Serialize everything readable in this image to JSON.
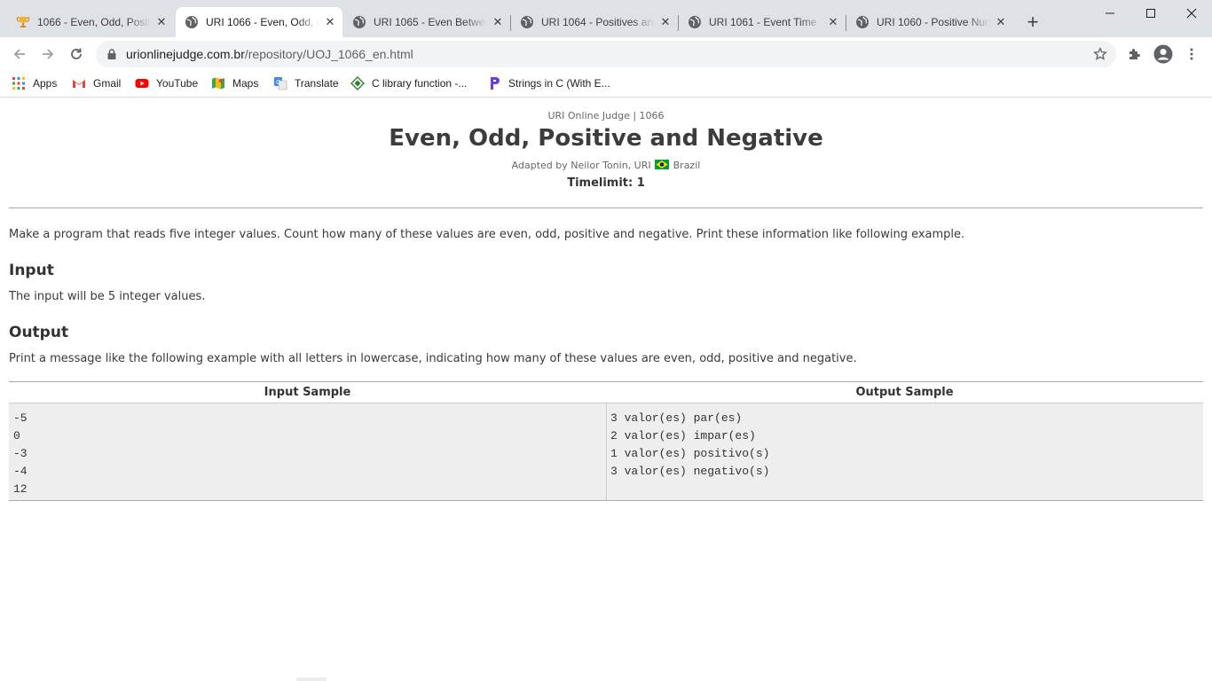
{
  "tabs": [
    {
      "title": "1066 - Even, Odd, Positive and Negative",
      "favicon": "trophy-icon"
    },
    {
      "title": "URI 1066 - Even, Odd, Positive and Negative",
      "favicon": "globe-icon"
    },
    {
      "title": "URI 1065 - Even Between five Numbers",
      "favicon": "globe-icon"
    },
    {
      "title": "URI 1064 - Positives and Average",
      "favicon": "globe-icon"
    },
    {
      "title": "URI 1061 - Event Time",
      "favicon": "globe-icon"
    },
    {
      "title": "URI 1060 - Positive Numbers",
      "favicon": "globe-icon"
    }
  ],
  "address_bar": {
    "host": "urionlinejudge.com.br",
    "path": "/repository/UOJ_1066_en.html"
  },
  "bookmarks": [
    {
      "label": "Apps",
      "icon": "apps-grid-icon"
    },
    {
      "label": "Gmail",
      "icon": "gmail-icon"
    },
    {
      "label": "YouTube",
      "icon": "youtube-icon"
    },
    {
      "label": "Maps",
      "icon": "maps-icon"
    },
    {
      "label": "Translate",
      "icon": "translate-icon"
    },
    {
      "label": "C library function -...",
      "icon": "diamond-icon"
    },
    {
      "label": "Strings in C (With E...",
      "icon": "programiz-icon"
    }
  ],
  "problem": {
    "source": "URI Online Judge | 1066",
    "title": "Even, Odd, Positive and Negative",
    "adapted_prefix": "Adapted by Neilor Tonin, URI",
    "adapted_country": "Brazil",
    "timelimit": "Timelimit: 1",
    "description": "Make a program that reads five integer values. Count how many   of these values are even, odd, positive and negative. Print these information like following example.",
    "input_heading": "Input",
    "input_text": "The input will be 5 integer values.",
    "output_heading": "Output",
    "output_text": "Print a message like the following example with all letters in lowercase, indicating how many of these values are even, odd, positive and negative."
  },
  "samples": {
    "input_header": "Input Sample",
    "output_header": "Output Sample",
    "input_lines": "-5\n0\n-3\n-4\n12",
    "output_lines": "3 valor(es) par(es)\n2 valor(es) impar(es)\n1 valor(es) positivo(s)\n3 valor(es) negativo(s)"
  },
  "colors": {
    "tabstrip_bg": "#dee1e6",
    "omnibox_bg": "#f1f3f4",
    "sample_bg": "#eeeeee"
  }
}
